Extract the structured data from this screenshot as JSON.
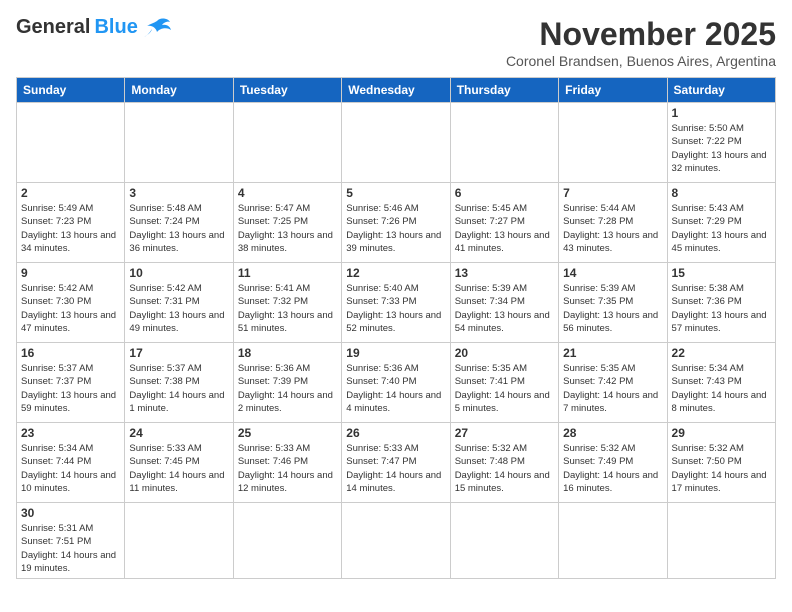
{
  "header": {
    "logo_general": "General",
    "logo_blue": "Blue",
    "month_title": "November 2025",
    "subtitle": "Coronel Brandsen, Buenos Aires, Argentina"
  },
  "weekdays": [
    "Sunday",
    "Monday",
    "Tuesday",
    "Wednesday",
    "Thursday",
    "Friday",
    "Saturday"
  ],
  "days": {
    "1": {
      "sunrise": "5:50 AM",
      "sunset": "7:22 PM",
      "daylight": "13 hours and 32 minutes."
    },
    "2": {
      "sunrise": "5:49 AM",
      "sunset": "7:23 PM",
      "daylight": "13 hours and 34 minutes."
    },
    "3": {
      "sunrise": "5:48 AM",
      "sunset": "7:24 PM",
      "daylight": "13 hours and 36 minutes."
    },
    "4": {
      "sunrise": "5:47 AM",
      "sunset": "7:25 PM",
      "daylight": "13 hours and 38 minutes."
    },
    "5": {
      "sunrise": "5:46 AM",
      "sunset": "7:26 PM",
      "daylight": "13 hours and 39 minutes."
    },
    "6": {
      "sunrise": "5:45 AM",
      "sunset": "7:27 PM",
      "daylight": "13 hours and 41 minutes."
    },
    "7": {
      "sunrise": "5:44 AM",
      "sunset": "7:28 PM",
      "daylight": "13 hours and 43 minutes."
    },
    "8": {
      "sunrise": "5:43 AM",
      "sunset": "7:29 PM",
      "daylight": "13 hours and 45 minutes."
    },
    "9": {
      "sunrise": "5:42 AM",
      "sunset": "7:30 PM",
      "daylight": "13 hours and 47 minutes."
    },
    "10": {
      "sunrise": "5:42 AM",
      "sunset": "7:31 PM",
      "daylight": "13 hours and 49 minutes."
    },
    "11": {
      "sunrise": "5:41 AM",
      "sunset": "7:32 PM",
      "daylight": "13 hours and 51 minutes."
    },
    "12": {
      "sunrise": "5:40 AM",
      "sunset": "7:33 PM",
      "daylight": "13 hours and 52 minutes."
    },
    "13": {
      "sunrise": "5:39 AM",
      "sunset": "7:34 PM",
      "daylight": "13 hours and 54 minutes."
    },
    "14": {
      "sunrise": "5:39 AM",
      "sunset": "7:35 PM",
      "daylight": "13 hours and 56 minutes."
    },
    "15": {
      "sunrise": "5:38 AM",
      "sunset": "7:36 PM",
      "daylight": "13 hours and 57 minutes."
    },
    "16": {
      "sunrise": "5:37 AM",
      "sunset": "7:37 PM",
      "daylight": "13 hours and 59 minutes."
    },
    "17": {
      "sunrise": "5:37 AM",
      "sunset": "7:38 PM",
      "daylight": "14 hours and 1 minute."
    },
    "18": {
      "sunrise": "5:36 AM",
      "sunset": "7:39 PM",
      "daylight": "14 hours and 2 minutes."
    },
    "19": {
      "sunrise": "5:36 AM",
      "sunset": "7:40 PM",
      "daylight": "14 hours and 4 minutes."
    },
    "20": {
      "sunrise": "5:35 AM",
      "sunset": "7:41 PM",
      "daylight": "14 hours and 5 minutes."
    },
    "21": {
      "sunrise": "5:35 AM",
      "sunset": "7:42 PM",
      "daylight": "14 hours and 7 minutes."
    },
    "22": {
      "sunrise": "5:34 AM",
      "sunset": "7:43 PM",
      "daylight": "14 hours and 8 minutes."
    },
    "23": {
      "sunrise": "5:34 AM",
      "sunset": "7:44 PM",
      "daylight": "14 hours and 10 minutes."
    },
    "24": {
      "sunrise": "5:33 AM",
      "sunset": "7:45 PM",
      "daylight": "14 hours and 11 minutes."
    },
    "25": {
      "sunrise": "5:33 AM",
      "sunset": "7:46 PM",
      "daylight": "14 hours and 12 minutes."
    },
    "26": {
      "sunrise": "5:33 AM",
      "sunset": "7:47 PM",
      "daylight": "14 hours and 14 minutes."
    },
    "27": {
      "sunrise": "5:32 AM",
      "sunset": "7:48 PM",
      "daylight": "14 hours and 15 minutes."
    },
    "28": {
      "sunrise": "5:32 AM",
      "sunset": "7:49 PM",
      "daylight": "14 hours and 16 minutes."
    },
    "29": {
      "sunrise": "5:32 AM",
      "sunset": "7:50 PM",
      "daylight": "14 hours and 17 minutes."
    },
    "30": {
      "sunrise": "5:31 AM",
      "sunset": "7:51 PM",
      "daylight": "14 hours and 19 minutes."
    }
  }
}
